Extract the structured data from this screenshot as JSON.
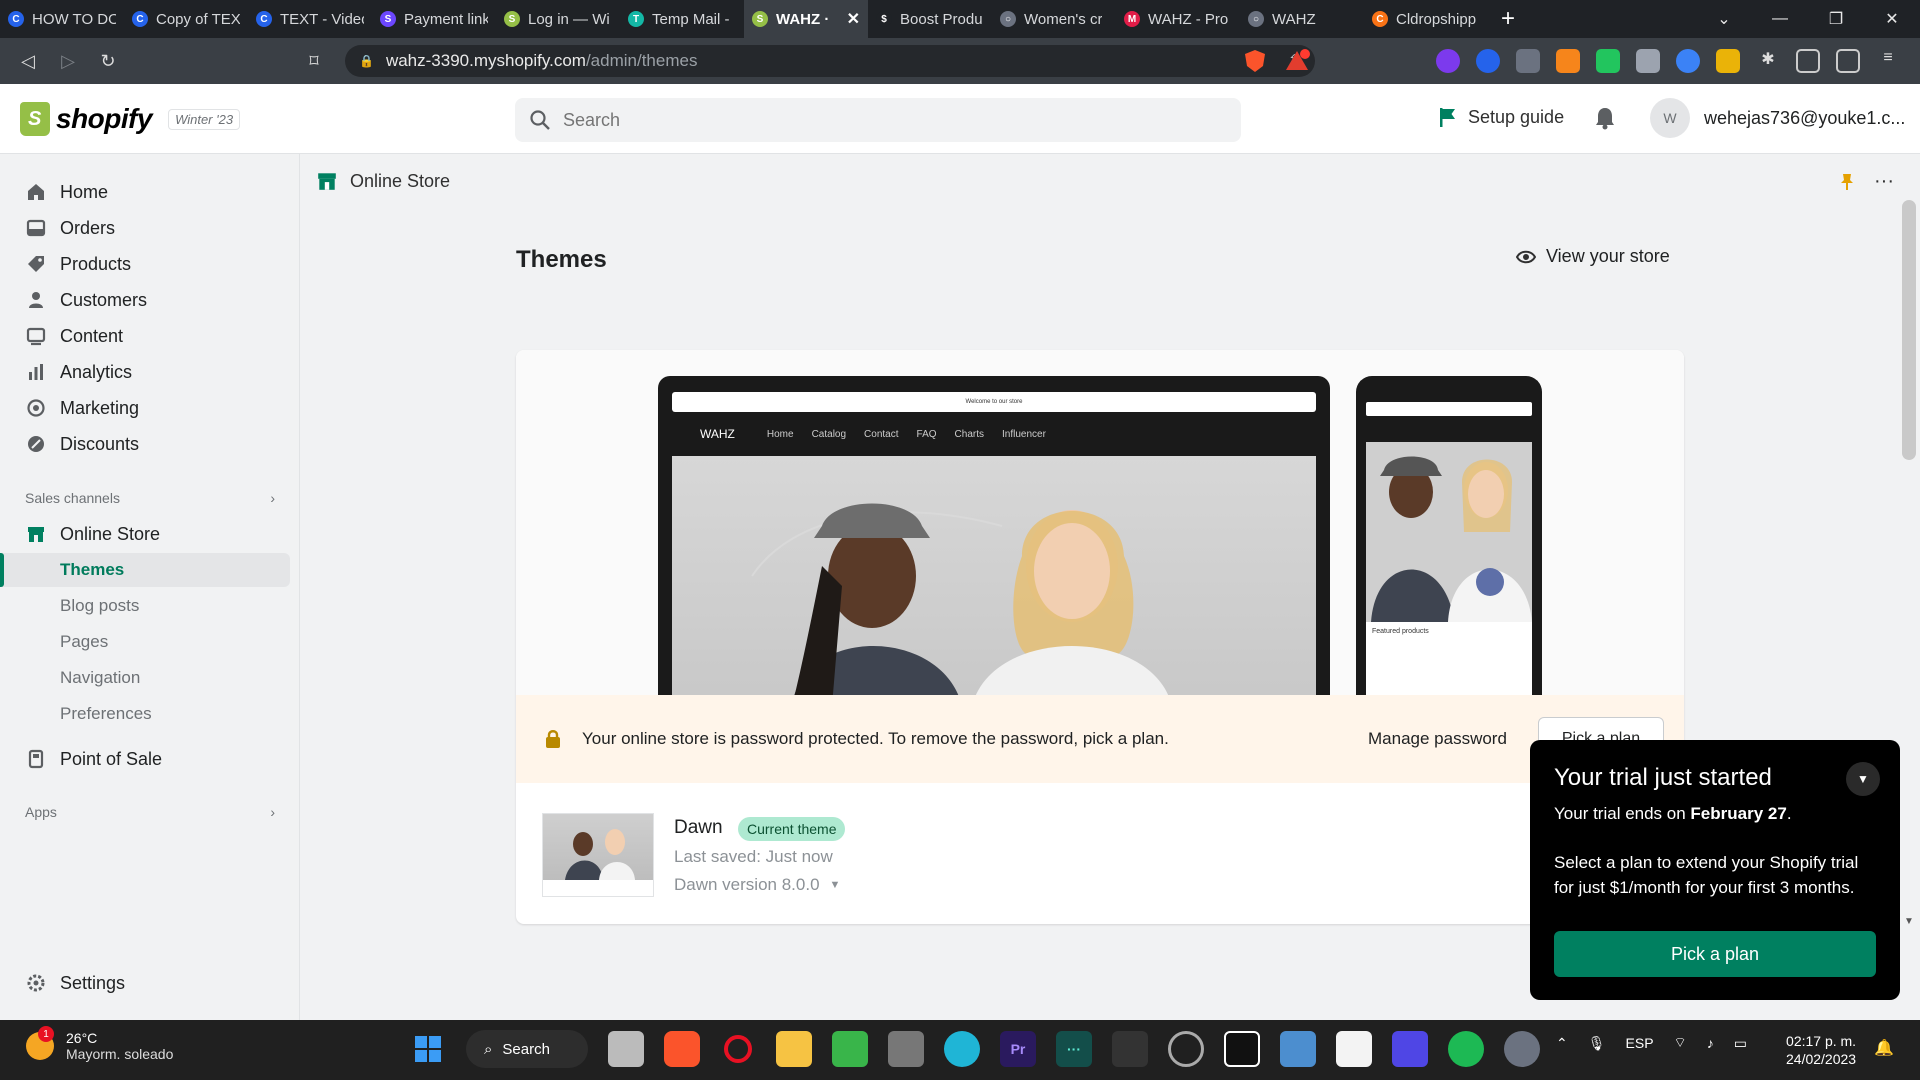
{
  "browser": {
    "tabs": [
      {
        "title": "HOW TO DO",
        "color": "#2563eb",
        "glyph": "C"
      },
      {
        "title": "Copy of TEXT",
        "color": "#2563eb",
        "glyph": "C"
      },
      {
        "title": "TEXT - Video",
        "color": "#2563eb",
        "glyph": "C"
      },
      {
        "title": "Payment link",
        "color": "#6c47ff",
        "glyph": "S"
      },
      {
        "title": "Log in — Wi",
        "color": "#95bf47",
        "glyph": "S"
      },
      {
        "title": "Temp Mail -",
        "color": "#14b8a6",
        "glyph": "T"
      },
      {
        "title": "WAHZ · ",
        "color": "#95bf47",
        "glyph": "S",
        "active": true
      },
      {
        "title": "Boost Produ",
        "color": "#1f2226",
        "glyph": "$"
      },
      {
        "title": "Women's cr",
        "color": "#6b7280",
        "glyph": "○"
      },
      {
        "title": "WAHZ - Pro",
        "color": "#e11d48",
        "glyph": "M"
      },
      {
        "title": "WAHZ",
        "color": "#6b7280",
        "glyph": "○"
      },
      {
        "title": "Cldropshipp",
        "color": "#f97316",
        "glyph": "C"
      }
    ],
    "new_tab": "+",
    "url_host": "wahz-3390.myshopify.com",
    "url_path": "/admin/themes"
  },
  "topbar": {
    "logo_text": "shopify",
    "edition": "Winter '23",
    "search_placeholder": "Search",
    "setup_guide": "Setup guide",
    "avatar_initial": "W",
    "account_email": "wehejas736@youke1.c..."
  },
  "sidebar": {
    "items": [
      {
        "label": "Home",
        "icon": "home-icon"
      },
      {
        "label": "Orders",
        "icon": "orders-icon"
      },
      {
        "label": "Products",
        "icon": "tag-icon"
      },
      {
        "label": "Customers",
        "icon": "person-icon"
      },
      {
        "label": "Content",
        "icon": "content-icon"
      },
      {
        "label": "Analytics",
        "icon": "bar-chart-icon"
      },
      {
        "label": "Marketing",
        "icon": "target-icon"
      },
      {
        "label": "Discounts",
        "icon": "discount-icon"
      }
    ],
    "sales_channels_label": "Sales channels",
    "online_store": "Online Store",
    "online_store_sub": [
      "Themes",
      "Blog posts",
      "Pages",
      "Navigation",
      "Preferences"
    ],
    "point_of_sale": "Point of Sale",
    "apps_label": "Apps",
    "settings": "Settings"
  },
  "main": {
    "breadcrumb": "Online Store",
    "title": "Themes",
    "view_store": "View your store",
    "preview": {
      "desktop_announcement": "Welcome to our store",
      "desktop_brand": "WAHZ",
      "desktop_nav": [
        "Home",
        "Catalog",
        "Contact",
        "FAQ",
        "Charts",
        "Influencer"
      ],
      "mobile_featured": "Featured products"
    },
    "password_banner": "Your online store is password protected. To remove the password, pick a plan.",
    "manage_password": "Manage password",
    "pick_plan": "Pick a plan",
    "theme": {
      "name": "Dawn",
      "badge": "Current theme",
      "last_saved": "Last saved: Just now",
      "version": "Dawn version 8.0.0",
      "more": "···"
    }
  },
  "trial": {
    "title": "Your trial just started",
    "ends_prefix": "Your trial ends on",
    "ends_date": "February 27",
    "description": "Select a plan to extend your Shopify trial for just $1/month for your first 3 months.",
    "button": "Pick a plan"
  },
  "taskbar": {
    "weather_temp": "26°C",
    "weather_desc": "Mayorm. soleado",
    "weather_badge": "1",
    "search": "Search",
    "lang": "ESP",
    "time": "02:17 p. m.",
    "date": "24/02/2023"
  },
  "colors": {
    "accent": "#008060",
    "badge_bg": "#aee9d1",
    "banner_bg": "#fff5ea",
    "shopify_green": "#95bf47"
  }
}
